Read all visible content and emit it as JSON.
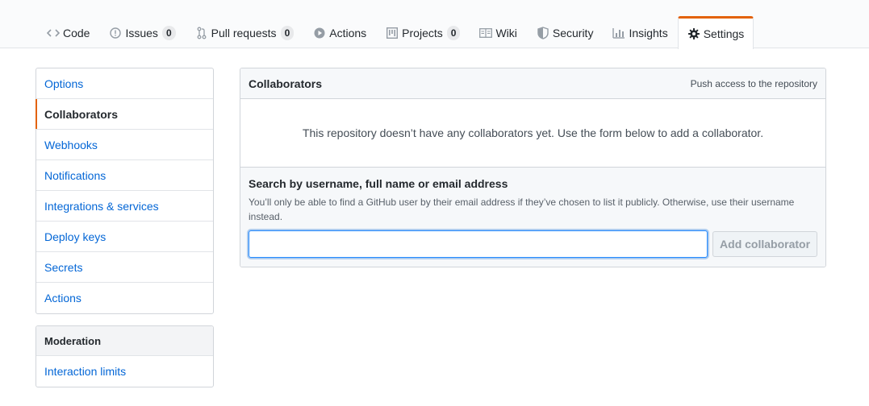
{
  "nav": {
    "tabs": [
      {
        "label": "Code",
        "icon": "code-icon"
      },
      {
        "label": "Issues",
        "icon": "issue-icon",
        "count": "0"
      },
      {
        "label": "Pull requests",
        "icon": "pull-request-icon",
        "count": "0"
      },
      {
        "label": "Actions",
        "icon": "play-icon"
      },
      {
        "label": "Projects",
        "icon": "project-icon",
        "count": "0"
      },
      {
        "label": "Wiki",
        "icon": "book-icon"
      },
      {
        "label": "Security",
        "icon": "shield-icon"
      },
      {
        "label": "Insights",
        "icon": "graph-icon"
      },
      {
        "label": "Settings",
        "icon": "gear-icon",
        "selected": true
      }
    ],
    "accent_color": "#e36209"
  },
  "sidebar": {
    "items": [
      {
        "label": "Options"
      },
      {
        "label": "Collaborators",
        "selected": true
      },
      {
        "label": "Webhooks"
      },
      {
        "label": "Notifications"
      },
      {
        "label": "Integrations & services"
      },
      {
        "label": "Deploy keys"
      },
      {
        "label": "Secrets"
      },
      {
        "label": "Actions"
      }
    ],
    "moderation": {
      "heading": "Moderation",
      "items": [
        {
          "label": "Interaction limits"
        }
      ]
    }
  },
  "collaborators": {
    "title": "Collaborators",
    "subtitle": "Push access to the repository",
    "empty_message": "This repository doesn’t have any collaborators yet. Use the form below to add a collaborator.",
    "form": {
      "title": "Search by username, full name or email address",
      "note": "You’ll only be able to find a GitHub user by their email address if they’ve chosen to list it publicly. Otherwise, use their username instead.",
      "input_value": "",
      "input_placeholder": "",
      "button_label": "Add collaborator"
    }
  }
}
